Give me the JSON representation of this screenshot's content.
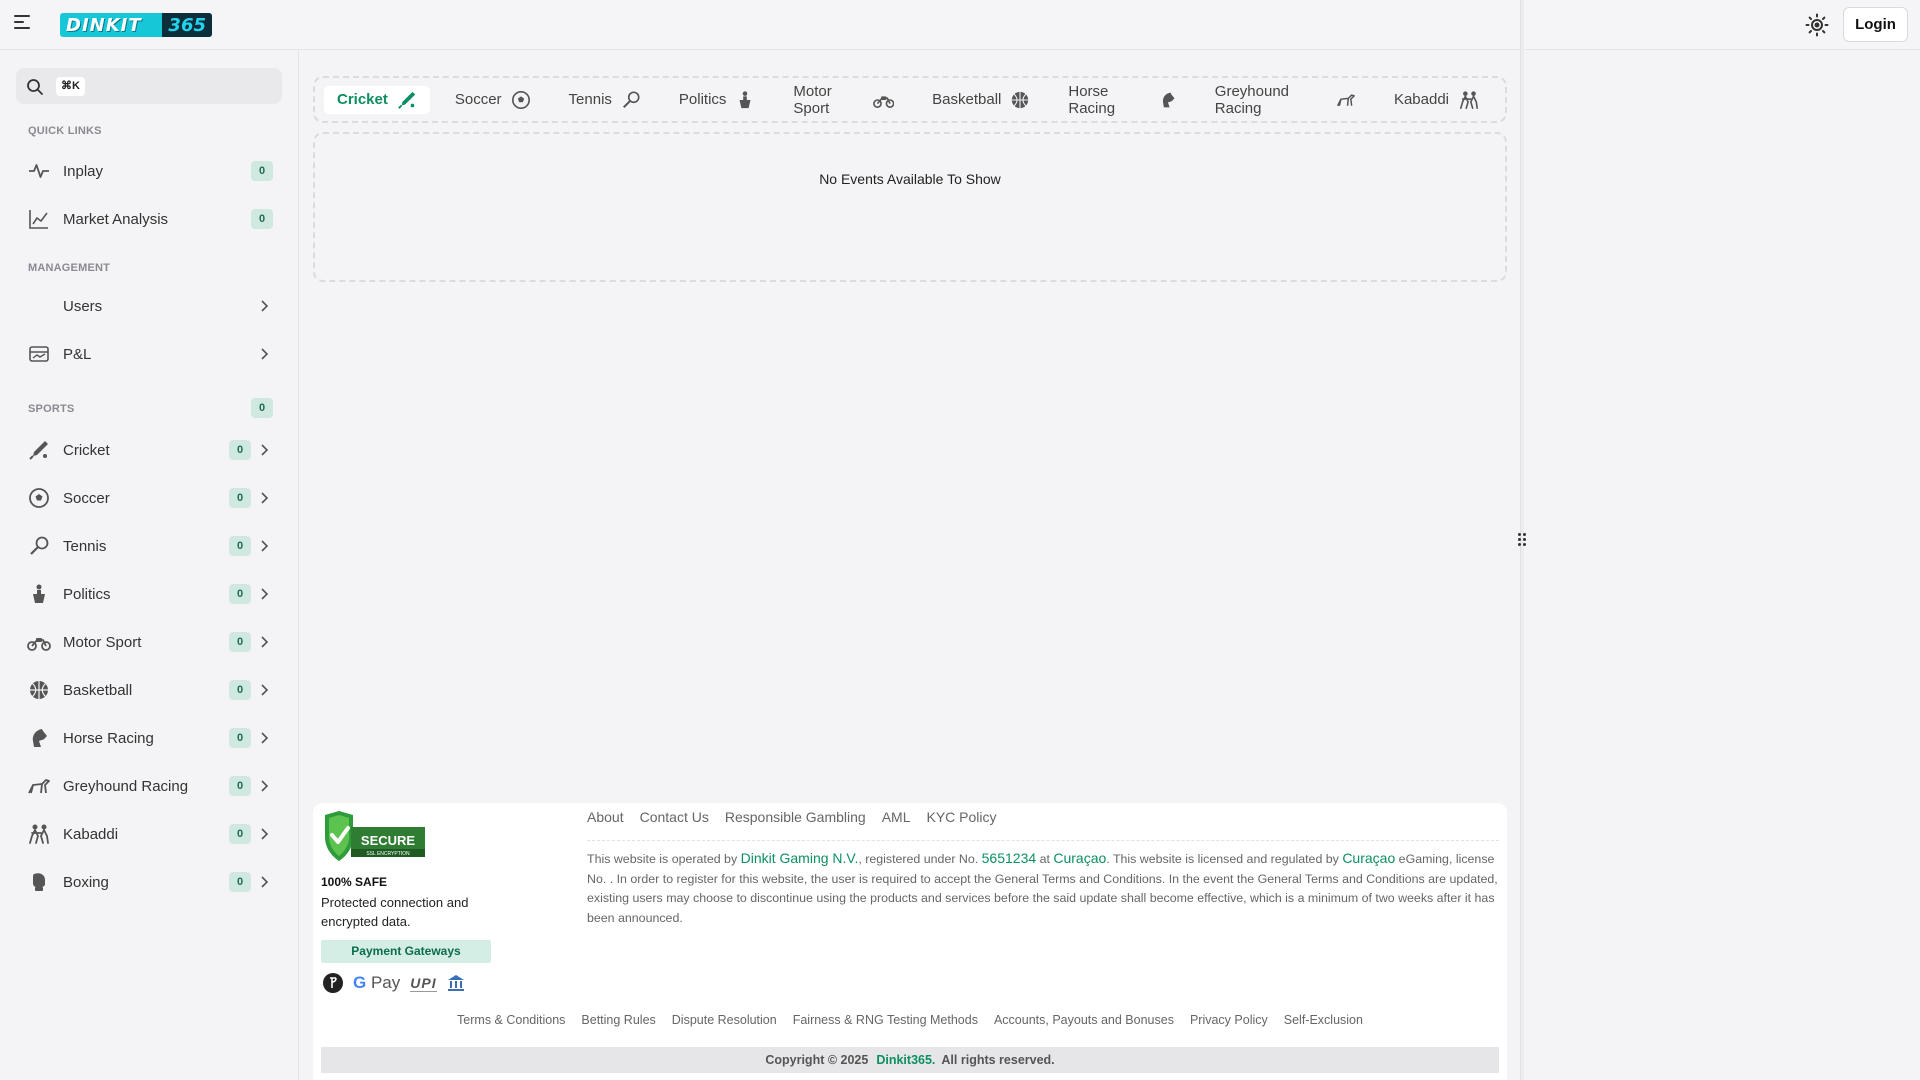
{
  "header": {
    "logo_word": "DINKIT",
    "logo_num": "365",
    "login_label": "Login"
  },
  "search": {
    "shortcut": "⌘K"
  },
  "sidebar": {
    "quick_links_title": "QUICK LINKS",
    "quick_links": [
      {
        "label": "Inplay",
        "count": "0",
        "icon": "activity-icon"
      },
      {
        "label": "Market Analysis",
        "count": "0",
        "icon": "chart-line-icon"
      }
    ],
    "management_title": "MANAGEMENT",
    "management": [
      {
        "label": "Users"
      },
      {
        "label": "P&L",
        "icon": "pnl-icon"
      }
    ],
    "sports_title": "SPORTS",
    "sports_count": "0",
    "sports": [
      {
        "label": "Cricket",
        "count": "0",
        "icon": "cricket-bat-icon"
      },
      {
        "label": "Soccer",
        "count": "0",
        "icon": "soccer-ball-icon"
      },
      {
        "label": "Tennis",
        "count": "0",
        "icon": "tennis-racket-icon"
      },
      {
        "label": "Politics",
        "count": "0",
        "icon": "podium-icon"
      },
      {
        "label": "Motor Sport",
        "count": "0",
        "icon": "motorbike-icon"
      },
      {
        "label": "Basketball",
        "count": "0",
        "icon": "basketball-icon"
      },
      {
        "label": "Horse Racing",
        "count": "0",
        "icon": "horse-icon"
      },
      {
        "label": "Greyhound Racing",
        "count": "0",
        "icon": "greyhound-icon"
      },
      {
        "label": "Kabaddi",
        "count": "0",
        "icon": "kabaddi-icon"
      },
      {
        "label": "Boxing",
        "count": "0",
        "icon": "boxing-glove-icon"
      }
    ]
  },
  "tabs": [
    {
      "label": "Cricket",
      "active": true
    },
    {
      "label": "Soccer"
    },
    {
      "label": "Tennis"
    },
    {
      "label": "Politics"
    },
    {
      "label": "Motor Sport"
    },
    {
      "label": "Basketball"
    },
    {
      "label": "Horse Racing"
    },
    {
      "label": "Greyhound Racing"
    },
    {
      "label": "Kabaddi"
    }
  ],
  "events": {
    "empty_message": "No Events Available To Show"
  },
  "footer": {
    "safe_title": "100% SAFE",
    "safe_text": "Protected connection and encrypted data.",
    "payment_label": "Payment Gateways",
    "secure_badge": "SECURE",
    "secure_sub": "SSL ENCRYPTION",
    "top_links": [
      "About",
      "Contact Us",
      "Responsible Gambling",
      "AML",
      "KYC Policy"
    ],
    "para": {
      "p1": "This website is operated by ",
      "operator": "Dinkit Gaming N.V.",
      "p2": ", registered under No. ",
      "reg_no": "5651234",
      "p3": " at ",
      "country": "Curaçao",
      "p4": ". This website is licensed and regulated by ",
      "regulator": "Curaçao",
      "p5": " eGaming, license No. . In order to register for this website, the user is required to accept the General Terms and Conditions. In the event the General Terms and Conditions are updated, existing users may choose to discontinue using the products and services before the said update shall become effective, which is a minimum of two weeks after it has been announced."
    },
    "bottom_links": [
      "Terms & Conditions",
      "Betting Rules",
      "Dispute Resolution",
      "Fairness & RNG Testing Methods",
      "Accounts, Payouts and Bonuses",
      "Privacy Policy",
      "Self-Exclusion"
    ],
    "copyright_prefix": "Copyright © 2025",
    "copyright_brand": "Dinkit365.",
    "copyright_suffix": "All rights reserved."
  },
  "colors": {
    "accent": "#0c8e63",
    "badge_bg": "#cfe9e1",
    "logo": "#16c7d8"
  }
}
